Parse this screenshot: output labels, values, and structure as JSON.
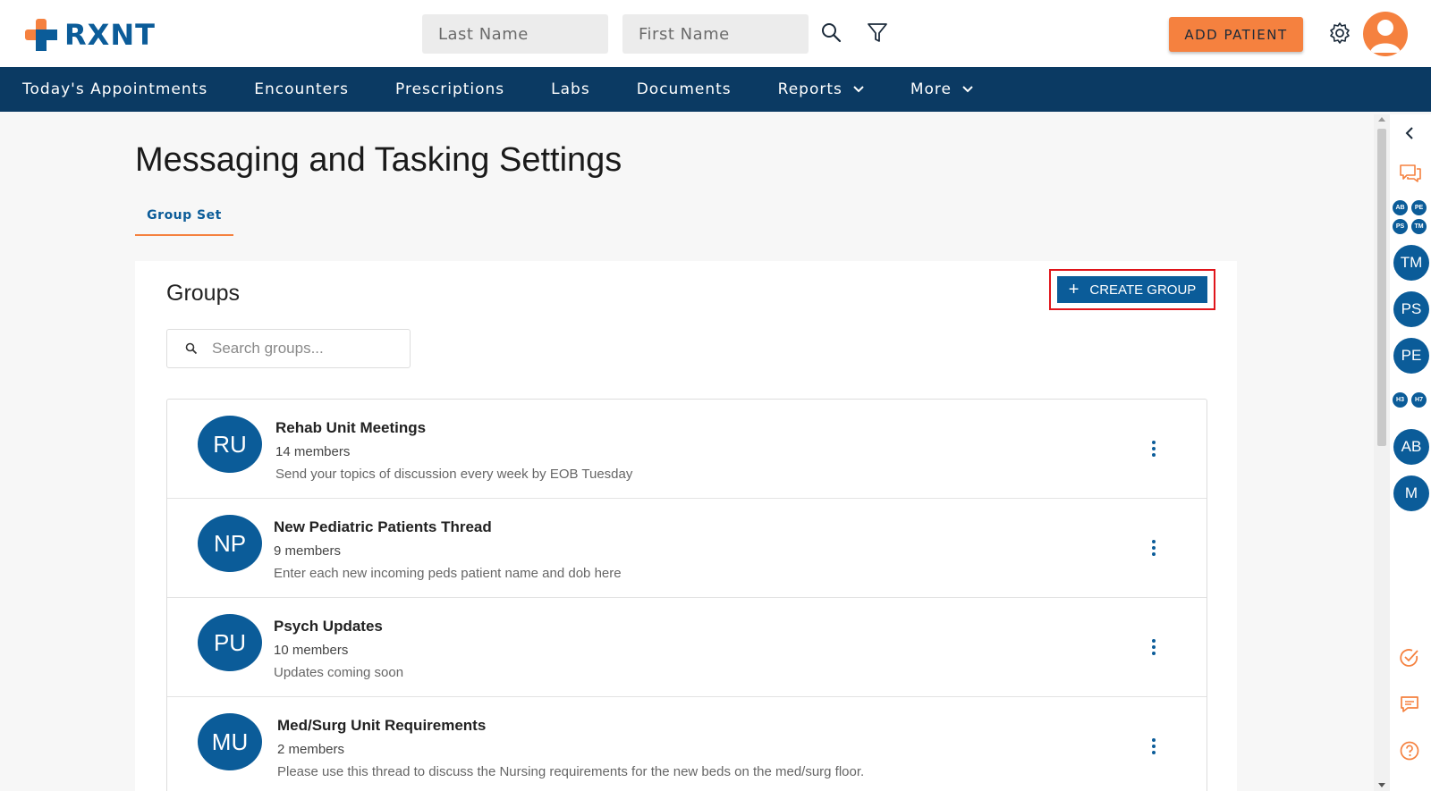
{
  "header": {
    "logo_text": "RXNT",
    "last_name_placeholder": "Last Name",
    "first_name_placeholder": "First Name",
    "add_patient_label": "ADD PATIENT",
    "colors": {
      "brand_blue": "#0b5c99",
      "accent_orange": "#f5813f",
      "nav_bg": "#0b3a63"
    }
  },
  "nav": {
    "items": [
      {
        "label": "Today's Appointments",
        "dropdown": false
      },
      {
        "label": "Encounters",
        "dropdown": false
      },
      {
        "label": "Prescriptions",
        "dropdown": false
      },
      {
        "label": "Labs",
        "dropdown": false
      },
      {
        "label": "Documents",
        "dropdown": false
      },
      {
        "label": "Reports",
        "dropdown": true
      },
      {
        "label": "More",
        "dropdown": true
      }
    ]
  },
  "main": {
    "title": "Messaging and Tasking Settings",
    "tab_label": "Group Set",
    "groups_title": "Groups",
    "create_group_label": "CREATE GROUP",
    "search_placeholder": "Search groups...",
    "groups": [
      {
        "initials": "RU",
        "name": "Rehab Unit Meetings",
        "members": "14 members",
        "description": "Send your topics of discussion every week by EOB Tuesday"
      },
      {
        "initials": "NP",
        "name": "New Pediatric Patients Thread",
        "members": "9 members",
        "description": "Enter each new incoming peds patient name and dob here"
      },
      {
        "initials": "PU",
        "name": "Psych Updates",
        "members": "10 members",
        "description": "Updates coming soon"
      },
      {
        "initials": "MU",
        "name": "Med/Surg Unit Requirements",
        "members": "2 members",
        "description": "Please use this thread to discuss the Nursing requirements for the new beds on the med/surg floor."
      }
    ]
  },
  "rail": {
    "cluster_top": [
      "AB",
      "PE",
      "PS",
      "TM"
    ],
    "avatars_a": [
      "TM",
      "PS",
      "PE"
    ],
    "cluster_mid": [
      "H3",
      "H7"
    ],
    "avatars_b": [
      "AB",
      "M"
    ],
    "icons": [
      "chevron-left-icon",
      "chat-bubbles-icon",
      "task-check-icon",
      "message-icon",
      "help-icon"
    ]
  }
}
